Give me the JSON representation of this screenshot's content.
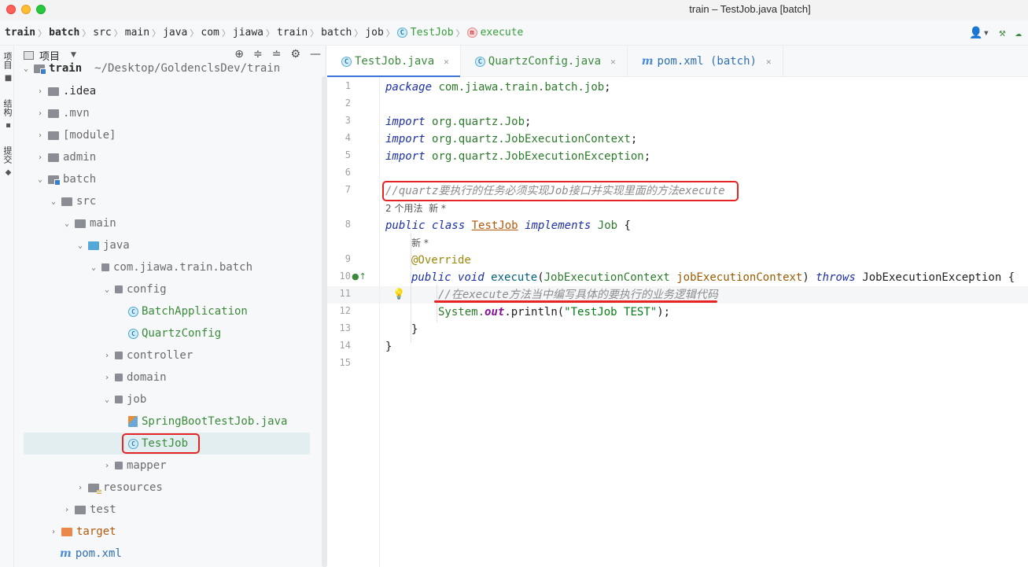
{
  "window": {
    "title": "train – TestJob.java [batch]"
  },
  "breadcrumb": {
    "items": [
      "train",
      "batch",
      "src",
      "main",
      "java",
      "com",
      "jiawa",
      "train",
      "batch",
      "job"
    ],
    "class_name": "TestJob",
    "method_name": "execute",
    "class_icon": "C",
    "method_icon": "m"
  },
  "side_tabs": {
    "project": "项目",
    "structure": "结构",
    "commit": "提交"
  },
  "project_panel": {
    "title": "项目"
  },
  "tree": {
    "root": "train",
    "root_path": "~/Desktop/GoldenclsDev/train",
    "idea": ".idea",
    "mvn": ".mvn",
    "module": "[module]",
    "admin": "admin",
    "batch": "batch",
    "src": "src",
    "main": "main",
    "java": "java",
    "package": "com.jiawa.train.batch",
    "config": "config",
    "batch_application": "BatchApplication",
    "quartz_config": "QuartzConfig",
    "controller": "controller",
    "domain": "domain",
    "job": "job",
    "spring_boot_test_job": "SpringBootTestJob.java",
    "test_job": "TestJob",
    "mapper": "mapper",
    "resources": "resources",
    "test": "test",
    "target": "target",
    "pom": "pom.xml",
    "mvn_mark": "m",
    "class_mark": "C"
  },
  "tabs": [
    {
      "label": "TestJob.java",
      "active": true
    },
    {
      "label": "QuartzConfig.java",
      "active": false
    },
    {
      "label": "pom.xml (batch)",
      "active": false
    }
  ],
  "editor": {
    "line_numbers": [
      "1",
      "2",
      "3",
      "4",
      "5",
      "6",
      "7",
      "",
      "8",
      "",
      "9",
      "10",
      "11",
      "12",
      "13",
      "14",
      "15"
    ],
    "code": {
      "l1_kw": "package",
      "l1_pkg": "com.jiawa.train.batch.job",
      "l1_end": ";",
      "import_kw": "import",
      "l3_pkg": "org.quartz.Job",
      "l4_pkg": "org.quartz.JobExecutionContext",
      "l5_pkg": "org.quartz.JobExecutionException",
      "semicolon": ";",
      "l7_comment": "//quartz要执行的任务必须实现Job接口并实现里面的方法execute",
      "usage_hint": "2 个用法  新 *",
      "l8_public": "public",
      "l8_class": "class",
      "l8_name": "TestJob",
      "l8_implements": "implements",
      "l8_job": "Job",
      "l8_brace": " {",
      "new_hint": "新 *",
      "l9_ann": "@Override",
      "l10_public": "public",
      "l10_void": "void",
      "l10_method": "execute",
      "l10_paren_open": "(",
      "l10_type": "JobExecutionContext",
      "l10_param": "jobExecutionContext",
      "l10_paren_close": ")",
      "l10_throws": "throws",
      "l10_exc": "JobExecutionException",
      "l10_brace": " {",
      "l11_comment": "//在execute方法当中编写具体的要执行的业务逻辑代码",
      "l12_system": "System.",
      "l12_out": "out",
      "l12_println": ".println(",
      "l12_str": "\"TestJob TEST\"",
      "l12_end": ");",
      "l13_close": "}",
      "l14_close": "}"
    }
  },
  "colors": {
    "highlight_red": "#e62424",
    "accent_blue": "#3a75d8"
  }
}
